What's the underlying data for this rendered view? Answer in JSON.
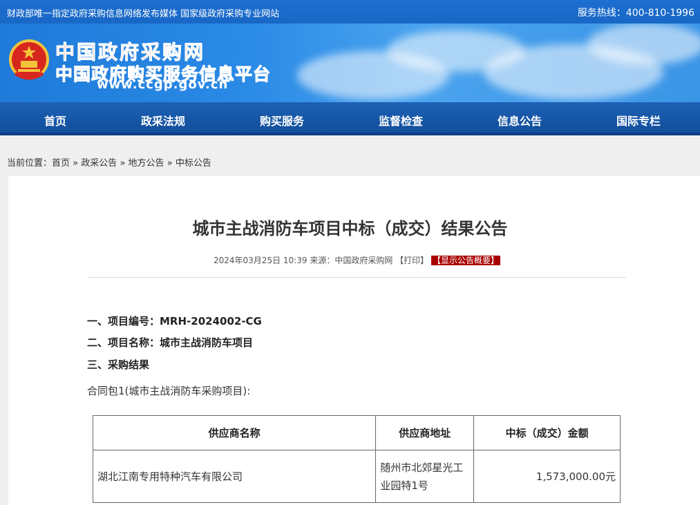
{
  "topbar": {
    "slogan": "财政部唯一指定政府采购信息网络发布媒体 国家级政府采购专业网站",
    "hotline": "服务热线：400-810-1996"
  },
  "header": {
    "site_name": "中国政府采购网",
    "site_subtitle": "中国政府购买服务信息平台",
    "site_url": "www.ccgp.gov.cn"
  },
  "nav": {
    "items": [
      "首页",
      "政采法规",
      "购买服务",
      "监督检查",
      "信息公告",
      "国际专栏"
    ]
  },
  "breadcrumb": {
    "prefix": "当前位置：",
    "items": [
      "首页",
      "政采公告",
      "地方公告",
      "中标公告"
    ],
    "separator": "»"
  },
  "article": {
    "title": "城市主战消防车项目中标（成交）结果公告",
    "datetime": "2024年03月25日 10:39",
    "source": "来源：中国政府采购网",
    "print_label": "【打印】",
    "summary_label": "【显示公告概要】",
    "sections": [
      "一、项目编号：MRH-2024002-CG",
      "二、项目名称：城市主战消防车项目",
      "三、采购结果"
    ],
    "package_label": "合同包1(城市主战消防车采购项目):",
    "table": {
      "headers": [
        "供应商名称",
        "供应商地址",
        "中标（成交）金额"
      ],
      "rows": [
        [
          "湖北江南专用特种汽车有限公司",
          "随州市北郊星光工业园特1号",
          "1,573,000.00元"
        ]
      ]
    }
  },
  "colors": {
    "topbar": "#1d6fd0",
    "nav": "#1c60b4",
    "brand_red": "#e8201a",
    "summary_badge": "#a80000"
  }
}
